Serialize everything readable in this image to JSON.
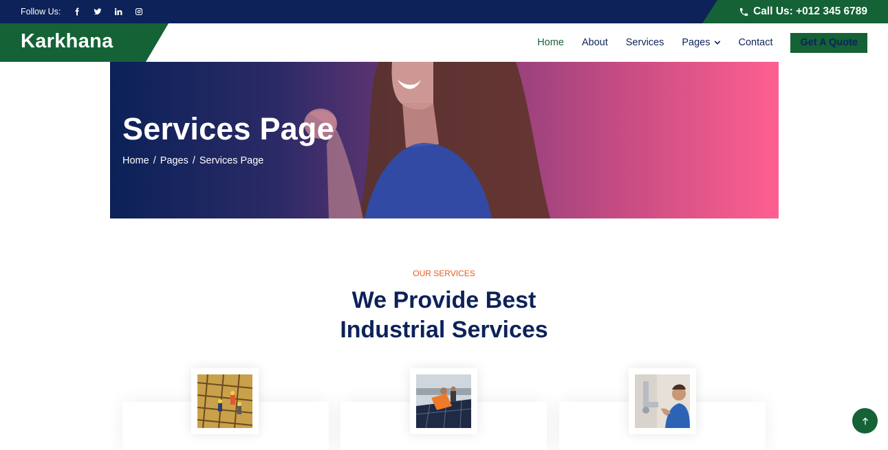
{
  "topbar": {
    "follow_label": "Follow Us:",
    "social_icons": [
      "facebook-icon",
      "twitter-icon",
      "linkedin-icon",
      "instagram-icon"
    ],
    "call_label": "Call Us: +012 345 6789"
  },
  "brand": {
    "name": "Karkhana"
  },
  "nav": {
    "items": [
      "Home",
      "About",
      "Services",
      "Pages",
      "Contact"
    ],
    "active": "Home",
    "cta": "Get A Quote"
  },
  "hero": {
    "title": "Services Page",
    "breadcrumb": [
      "Home",
      "Pages",
      "Services Page"
    ]
  },
  "section": {
    "eyebrow": "OUR SERVICES",
    "heading_line1": "We Provide Best",
    "heading_line2": "Industrial Services"
  },
  "colors": {
    "navy": "#0d2259",
    "green": "#146236",
    "orange": "#e85a1c",
    "pink": "#ff5f90"
  }
}
